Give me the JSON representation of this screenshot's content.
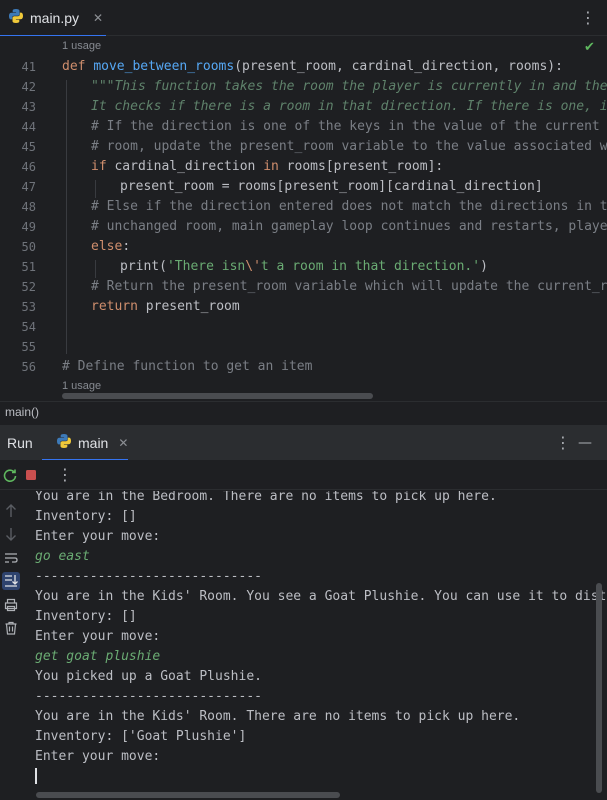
{
  "editor_tab": {
    "filename": "main.py"
  },
  "editor": {
    "usage_hint_top": "1 usage",
    "usage_hint_bottom": "1 usage",
    "line_numbers": [
      "41",
      "42",
      "43",
      "44",
      "45",
      "46",
      "47",
      "48",
      "49",
      "50",
      "51",
      "52",
      "53",
      "54",
      "55",
      "56"
    ],
    "lines": {
      "l41_def": "def ",
      "l41_name": "move_between_rooms",
      "l41_rest": "(present_room, cardinal_direction, rooms):",
      "l42": "\"\"\"This function takes the room the player is currently in and their in",
      "l43": "It checks if there is a room in that direction. If there is one, it re",
      "l44": "# If the direction is one of the keys in the value of the current room",
      "l45": "# room, update the present_room variable to the value associated with",
      "l46_kw": "if ",
      "l46_a": "cardinal_direction ",
      "l46_in": "in",
      "l46_b": " rooms[present_room]:",
      "l47": "present_room = rooms[present_room][cardinal_direction]",
      "l48": "# Else if the direction entered does not match the directions in the r",
      "l49": "# unchanged room, main gameplay loop continues and restarts, player wi",
      "l50": "else",
      "l50_colon": ":",
      "l51_print": "print(",
      "l51_s1": "'There isn",
      "l51_esc": "\\'",
      "l51_s2": "t a room in that direction.'",
      "l51_end": ")",
      "l52": "# Return the present_room variable which will update the current_room v",
      "l53_kw": "return",
      "l53_rest": " present_room",
      "l56": "# Define function to get an item"
    }
  },
  "breadcrumb": "main()",
  "run_window": {
    "title": "Run",
    "tab_label": "main"
  },
  "console": [
    {
      "text": "You are in the Bedroom. There are no items to pick up here.",
      "kind": "output"
    },
    {
      "text": "Inventory: []",
      "kind": "output"
    },
    {
      "text": "Enter your move:",
      "kind": "output"
    },
    {
      "text": "go east",
      "kind": "input"
    },
    {
      "text": "-----------------------------",
      "kind": "output"
    },
    {
      "text": "You are in the Kids' Room. You see a Goat Plushie. You can use it to distract",
      "kind": "output"
    },
    {
      "text": "Inventory: []",
      "kind": "output"
    },
    {
      "text": "Enter your move:",
      "kind": "output"
    },
    {
      "text": "get goat plushie",
      "kind": "input"
    },
    {
      "text": "You picked up a Goat Plushie.",
      "kind": "output"
    },
    {
      "text": "-----------------------------",
      "kind": "output"
    },
    {
      "text": "You are in the Kids' Room. There are no items to pick up here.",
      "kind": "output"
    },
    {
      "text": "Inventory: ['Goat Plushie']",
      "kind": "output"
    },
    {
      "text": "Enter your move:",
      "kind": "output"
    }
  ],
  "colors": {
    "background": "#1e1f22",
    "accent": "#3574f0",
    "keyword": "#cf8e6d",
    "function": "#56a8f5",
    "string": "#6aab73",
    "comment": "#7a7e85",
    "stop": "#c94f4f"
  },
  "icons": [
    "python-file-icon",
    "close-icon",
    "more-options-icon",
    "checkmark-icon",
    "rerun-icon",
    "stop-icon",
    "up-arrow-icon",
    "down-arrow-icon",
    "soft-wrap-icon",
    "scroll-to-end-icon",
    "print-icon",
    "trash-icon",
    "minimize-icon"
  ]
}
